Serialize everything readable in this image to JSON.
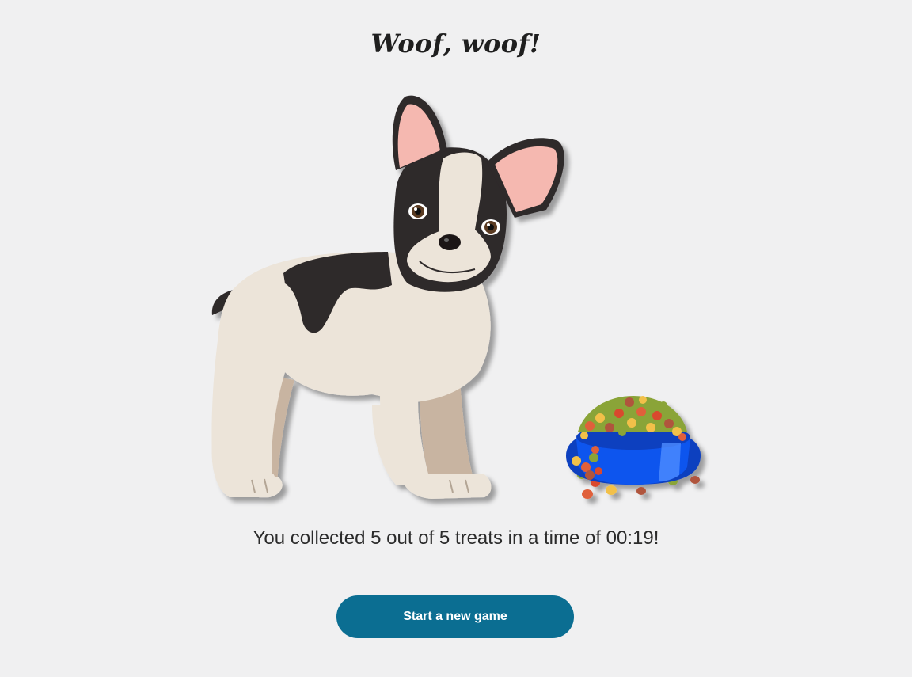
{
  "title": "Woof, woof!",
  "result": {
    "message": "You collected 5 out of 5 treats in a time of 00:19!",
    "treats_collected": 5,
    "treats_total": 5,
    "time": "00:19"
  },
  "button": {
    "label": "Start a new game"
  },
  "colors": {
    "background": "#f0f0f1",
    "button": "#0b6e92",
    "bowl": "#0a4fe0"
  },
  "icons": {
    "dog": "french-bulldog-illustration",
    "bowl": "food-bowl-illustration"
  }
}
